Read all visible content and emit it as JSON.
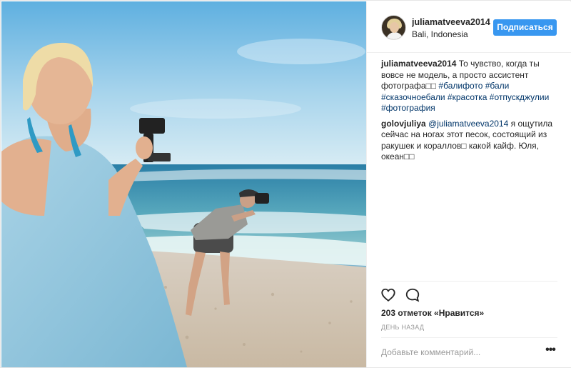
{
  "post": {
    "username": "juliamatveeva2014",
    "location": "Bali, Indonesia",
    "follow_label": "Подписаться",
    "comments": [
      {
        "author": "juliamatveeva2014",
        "segments": [
          {
            "type": "text",
            "value": " То чувство, когда ты вовсе не модель, а просто ассистент фотографа□□ "
          },
          {
            "type": "tag",
            "value": "#балифото"
          },
          {
            "type": "text",
            "value": " "
          },
          {
            "type": "tag",
            "value": "#бали"
          },
          {
            "type": "text",
            "value": " "
          },
          {
            "type": "tag",
            "value": "#сказочноебали"
          },
          {
            "type": "text",
            "value": " "
          },
          {
            "type": "tag",
            "value": "#красотка"
          },
          {
            "type": "text",
            "value": " "
          },
          {
            "type": "tag",
            "value": "#отпускджулии"
          },
          {
            "type": "text",
            "value": " "
          },
          {
            "type": "tag",
            "value": "#фотография"
          }
        ]
      },
      {
        "author": "golovjuliya",
        "segments": [
          {
            "type": "text",
            "value": " "
          },
          {
            "type": "mention",
            "value": "@juliamatveeva2014"
          },
          {
            "type": "text",
            "value": " я ощутила сейчас на ногах этот песок, состоящий из ракушек и кораллов□ какой кайф. Юля, океан□□"
          }
        ]
      }
    ],
    "likes_text": "203 отметок «Нравится»",
    "time_ago": "ДЕНЬ НАЗАД",
    "comment_placeholder": "Добавьте комментарий...",
    "more_label": "•••",
    "icons": {
      "like": "heart-outline-icon",
      "comment": "speech-bubble-icon"
    },
    "colors": {
      "follow_button": "#3897f0",
      "link": "#003569",
      "muted": "#999999"
    }
  }
}
